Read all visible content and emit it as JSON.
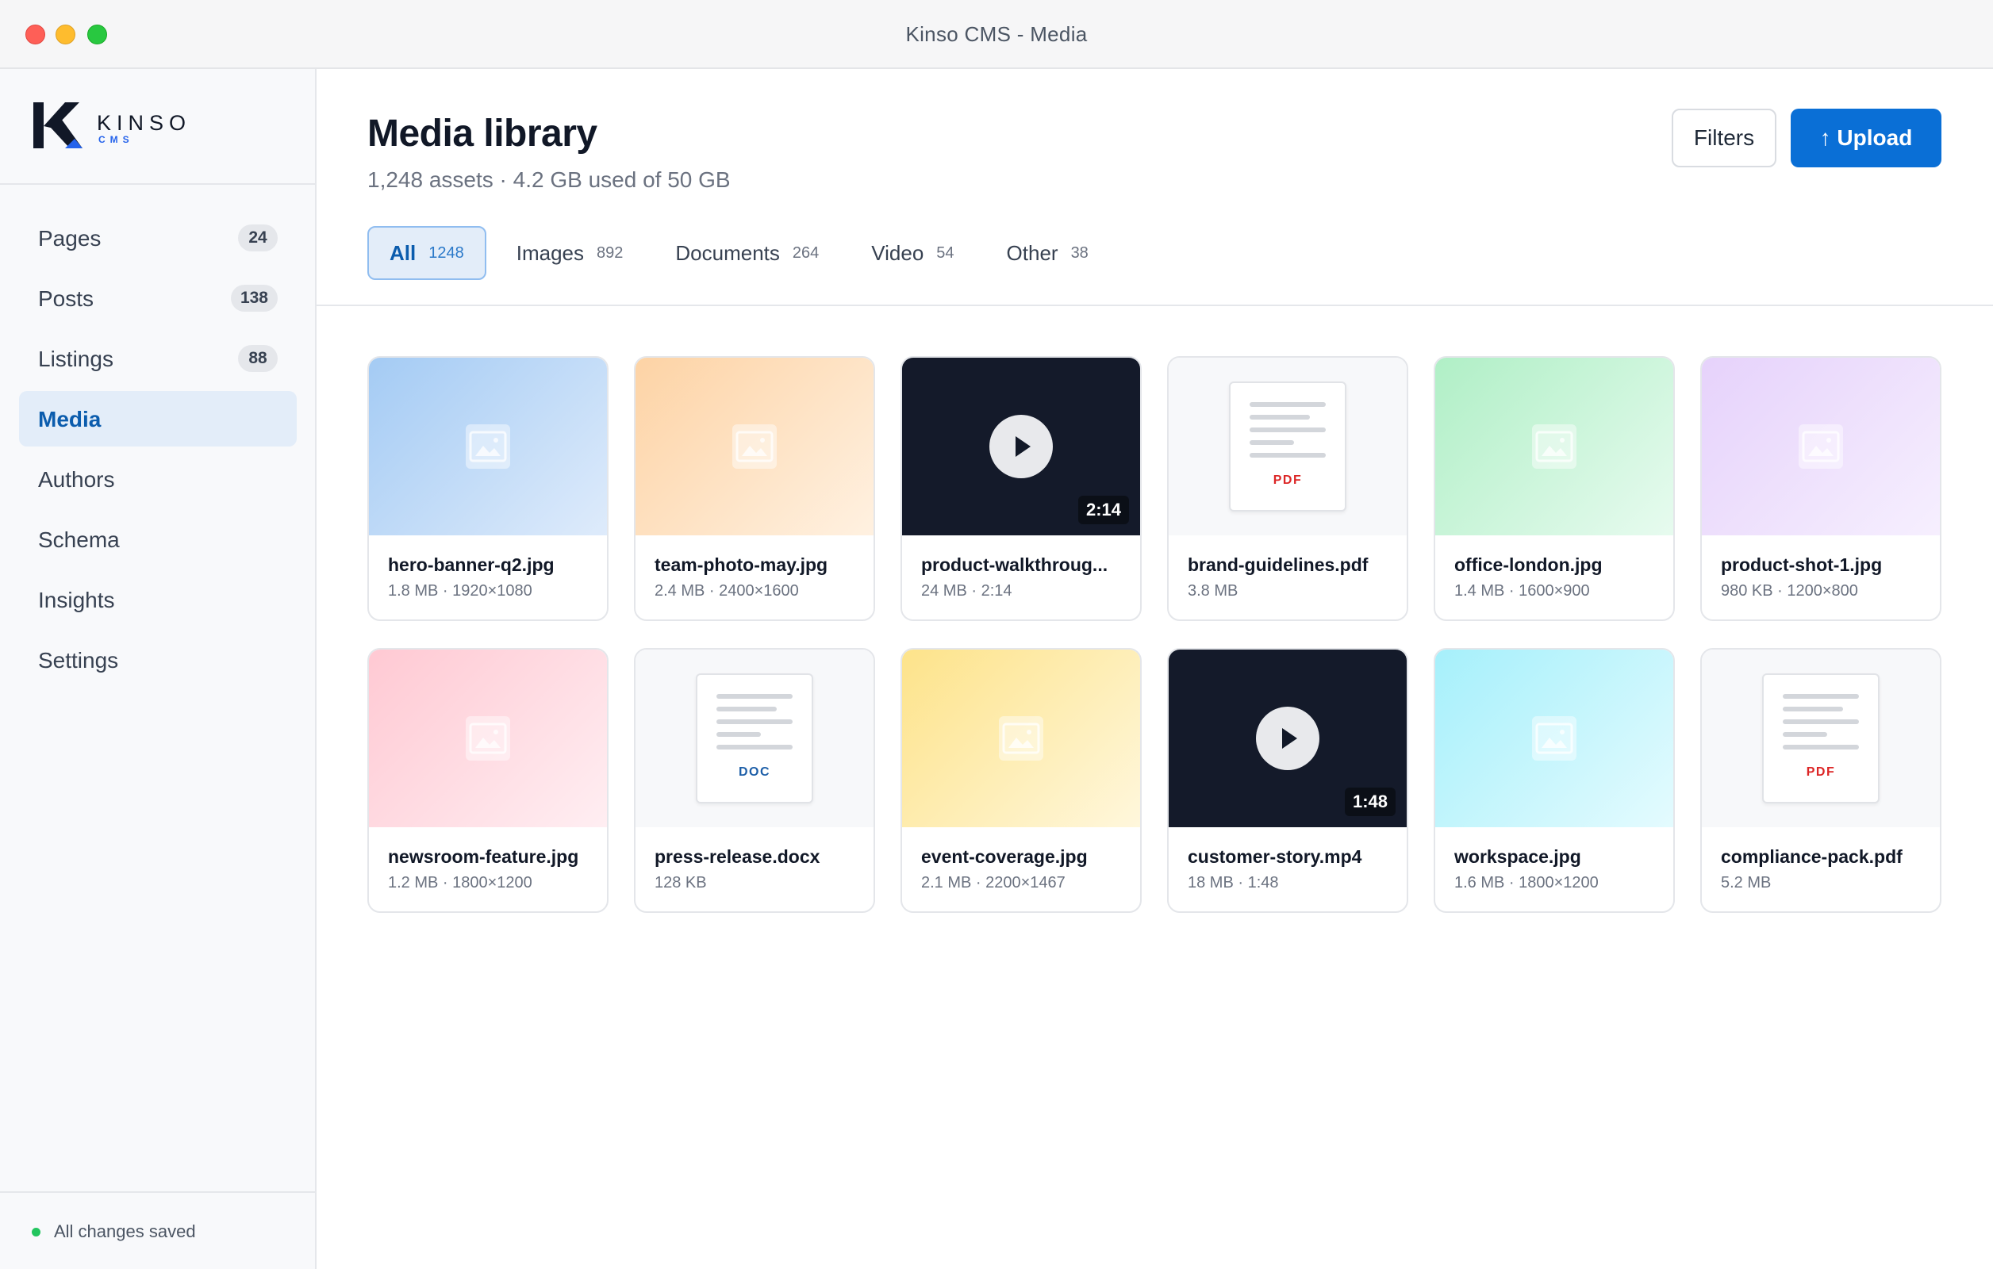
{
  "window": {
    "title": "Kinso CMS - Media"
  },
  "brand": {
    "name": "KINSO",
    "sub": "CMS"
  },
  "sidebar": {
    "items": [
      {
        "label": "Pages",
        "count": "24"
      },
      {
        "label": "Posts",
        "count": "138"
      },
      {
        "label": "Listings",
        "count": "88"
      },
      {
        "label": "Media",
        "count": null,
        "active": true
      },
      {
        "label": "Authors",
        "count": null
      },
      {
        "label": "Schema",
        "count": null
      },
      {
        "label": "Insights",
        "count": null
      },
      {
        "label": "Settings",
        "count": null
      }
    ],
    "status": "All changes saved"
  },
  "header": {
    "title": "Media library",
    "subtitle": "1,248 assets · 4.2 GB used of 50 GB",
    "filters_label": "Filters",
    "upload_label": "↑ Upload"
  },
  "tabs": [
    {
      "label": "All",
      "count": "1248",
      "active": true
    },
    {
      "label": "Images",
      "count": "892"
    },
    {
      "label": "Documents",
      "count": "264"
    },
    {
      "label": "Video",
      "count": "54"
    },
    {
      "label": "Other",
      "count": "38"
    }
  ],
  "assets": [
    {
      "kind": "image",
      "color": "blue",
      "name": "hero-banner-q2.jpg",
      "meta": "1.8 MB · 1920×1080"
    },
    {
      "kind": "image",
      "color": "orange",
      "name": "team-photo-may.jpg",
      "meta": "2.4 MB · 2400×1600"
    },
    {
      "kind": "video",
      "name": "product-walkthroug...",
      "meta": "24 MB · 2:14",
      "duration": "2:14"
    },
    {
      "kind": "doc",
      "doctype": "PDF",
      "name": "brand-guidelines.pdf",
      "meta": "3.8 MB"
    },
    {
      "kind": "image",
      "color": "green",
      "name": "office-london.jpg",
      "meta": "1.4 MB · 1600×900"
    },
    {
      "kind": "image",
      "color": "purple",
      "name": "product-shot-1.jpg",
      "meta": "980 KB · 1200×800"
    },
    {
      "kind": "image",
      "color": "pink",
      "name": "newsroom-feature.jpg",
      "meta": "1.2 MB · 1800×1200"
    },
    {
      "kind": "doc",
      "doctype": "DOC",
      "name": "press-release.docx",
      "meta": "128 KB"
    },
    {
      "kind": "image",
      "color": "yellow",
      "name": "event-coverage.jpg",
      "meta": "2.1 MB · 2200×1467"
    },
    {
      "kind": "video",
      "name": "customer-story.mp4",
      "meta": "18 MB · 1:48",
      "duration": "1:48"
    },
    {
      "kind": "image",
      "color": "cyan",
      "name": "workspace.jpg",
      "meta": "1.6 MB · 1800×1200"
    },
    {
      "kind": "doc",
      "doctype": "PDF",
      "name": "compliance-pack.pdf",
      "meta": "5.2 MB"
    }
  ],
  "colors": {
    "accent": "#0a6fd6",
    "active_bg": "#e3edf9",
    "status_ok": "#22c55e"
  }
}
